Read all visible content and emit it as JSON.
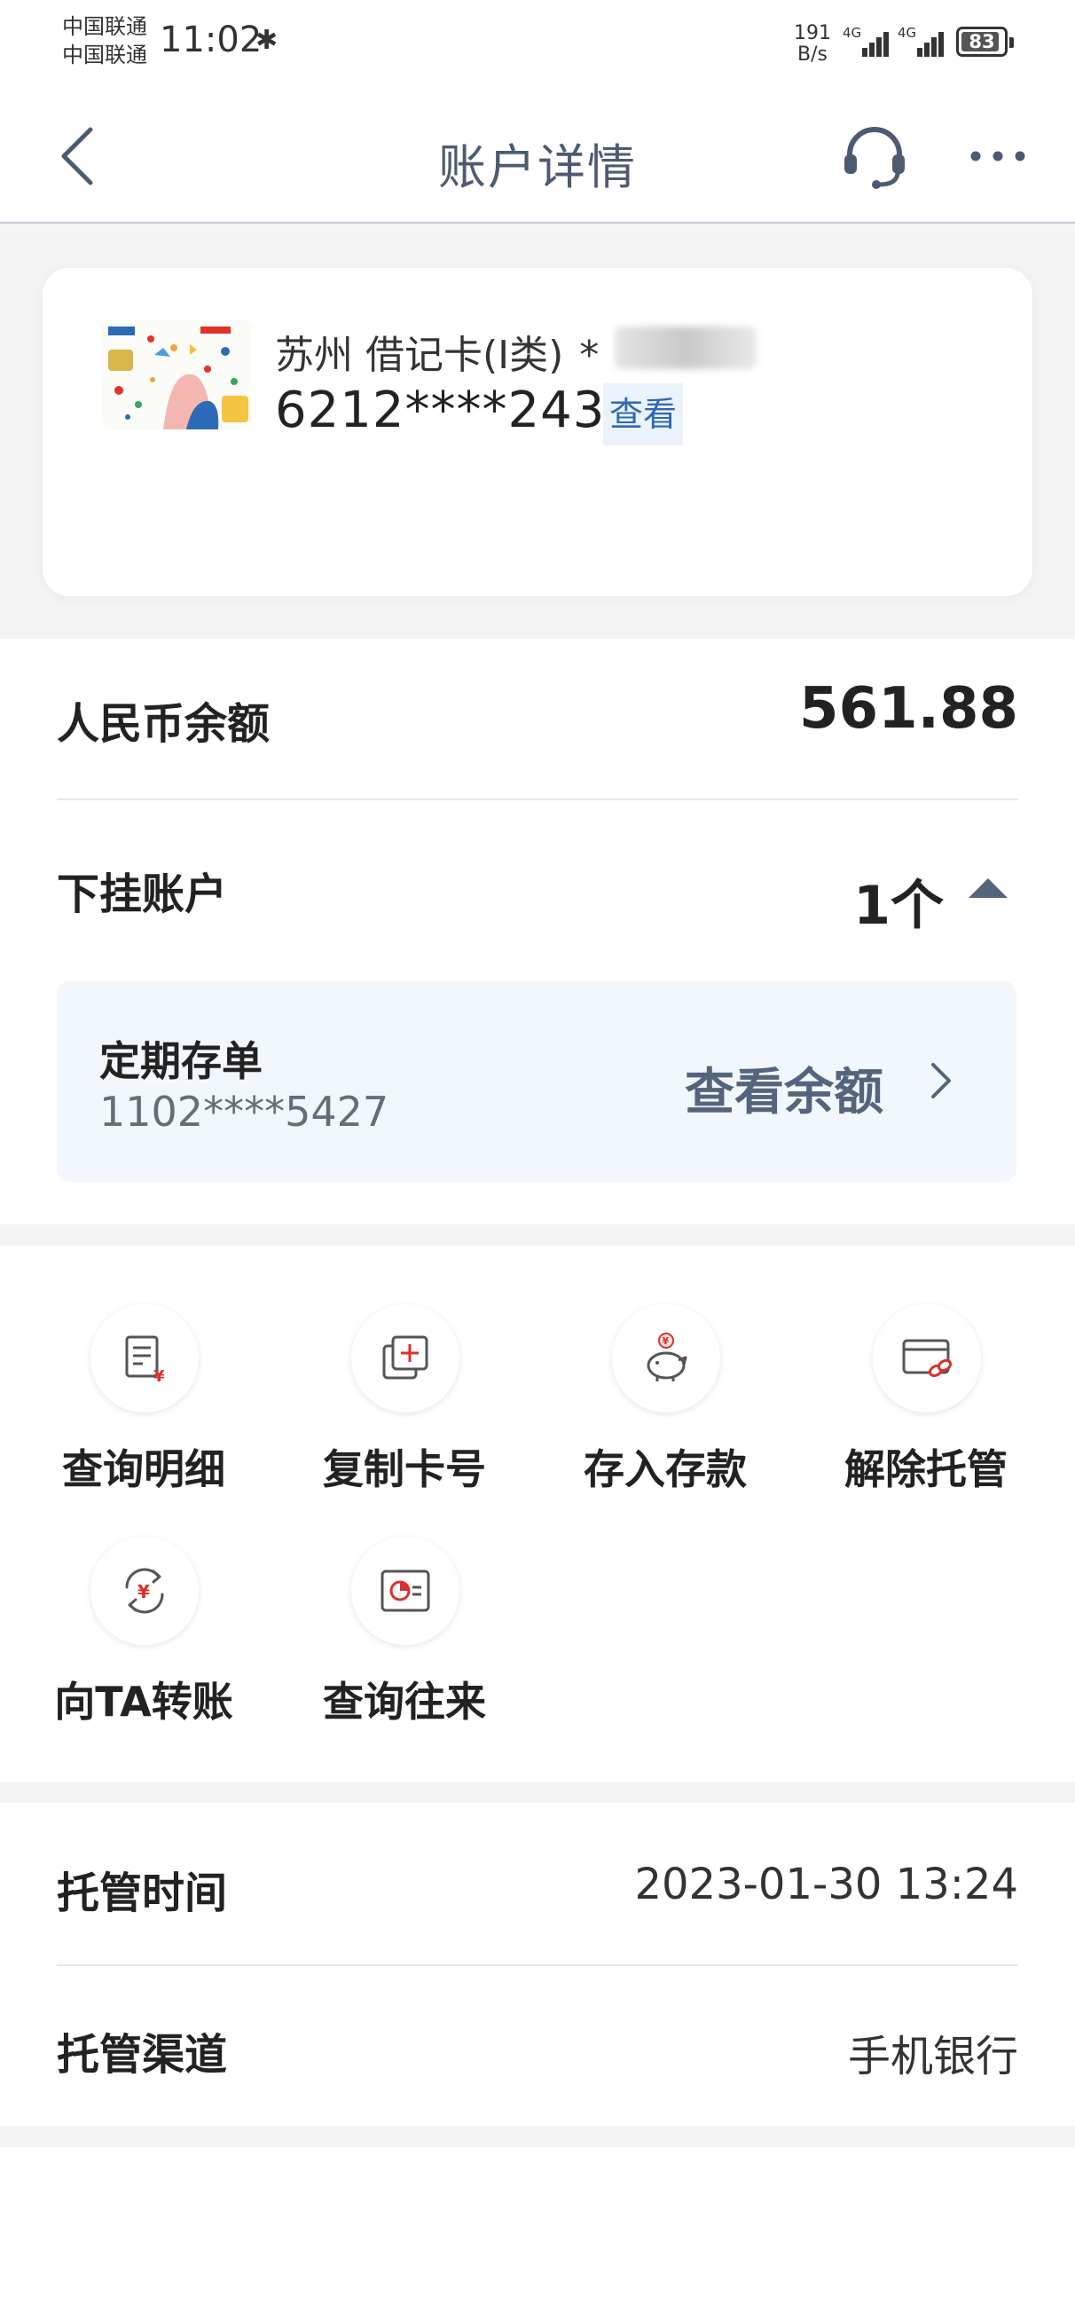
{
  "status_bar": {
    "carrier_1": "中国联通",
    "carrier_2": "中国联通",
    "time": "11:02",
    "net_speed_value": "191",
    "net_speed_unit": "B/s",
    "signal_1_label": "4G",
    "signal_2_label": "4G",
    "battery": "83"
  },
  "nav": {
    "title": "账户详情"
  },
  "card": {
    "name": "苏州 借记卡(I类)",
    "name_suffix": "*",
    "number": "6212****2432",
    "view_label": "查看"
  },
  "balance": {
    "label": "人民币余额",
    "amount": "561.88"
  },
  "sub_accounts": {
    "label": "下挂账户",
    "count": "1个",
    "items": [
      {
        "title": "定期存单",
        "number": "1102****5427",
        "action": "查看余额"
      }
    ]
  },
  "actions": [
    {
      "label": "查询明细",
      "icon": "document-yuan-icon"
    },
    {
      "label": "复制卡号",
      "icon": "copy-add-icon"
    },
    {
      "label": "存入存款",
      "icon": "piggy-bank-icon"
    },
    {
      "label": "解除托管",
      "icon": "card-unlink-icon"
    },
    {
      "label": "向TA转账",
      "icon": "transfer-yuan-icon"
    },
    {
      "label": "查询往来",
      "icon": "pie-chart-icon"
    }
  ],
  "custody": {
    "time_label": "托管时间",
    "time_value": "2023-01-30 13:24",
    "channel_label": "托管渠道",
    "channel_value": "手机银行"
  },
  "colors": {
    "accent_red": "#d9302c",
    "nav_text": "#4d5b71",
    "link_blue": "#2f68b5",
    "deposit_bg": "#f2f6fd"
  }
}
